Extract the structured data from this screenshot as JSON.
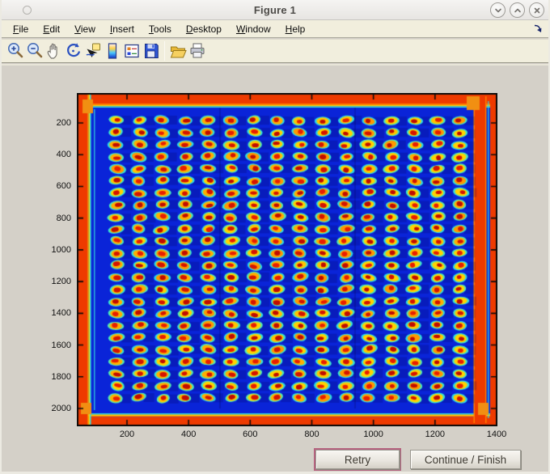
{
  "window": {
    "title": "Figure 1"
  },
  "window_controls": {
    "items": [
      "minimize",
      "maximize",
      "close"
    ]
  },
  "menu": {
    "items": [
      {
        "label": "File"
      },
      {
        "label": "Edit"
      },
      {
        "label": "View"
      },
      {
        "label": "Insert"
      },
      {
        "label": "Tools"
      },
      {
        "label": "Desktop"
      },
      {
        "label": "Window"
      },
      {
        "label": "Help"
      }
    ],
    "dock_icon": "curved-arrow-down-right"
  },
  "toolbar": {
    "buttons": [
      "zoom-in",
      "zoom-out",
      "pan",
      "rotate-3d",
      "data-cursor",
      "insert-colorbar",
      "insert-legend",
      "save-figure",
      "open-file",
      "print-figure"
    ],
    "separator_after": "save-figure"
  },
  "plot": {
    "x_tick_labels": [
      200,
      400,
      600,
      800,
      1000,
      1200,
      1400
    ],
    "y_tick_labels": [
      200,
      400,
      600,
      800,
      1000,
      1200,
      1400,
      1600,
      1800,
      2000
    ],
    "image": {
      "type": "heatmap-image",
      "description": "Jet-colormap scan of a microarray plate: deep blue field with a 16x24 grid of spots (red cores, yellow-orange rings, cyan halos), red-hot plate edges, an inner red vertical band near the right edge and orange corner blobs",
      "grid": {
        "cols": 16,
        "rows": 24
      },
      "colors": {
        "field": "#0a24d8",
        "halos": [
          "#35e3d6",
          "#45e8c0",
          "#2ad8e8",
          "#52eab4"
        ],
        "rings": [
          "#ffc400",
          "#ffae00",
          "#ff9800",
          "#ffd200"
        ],
        "cores": [
          "#e81e00",
          "#d41400",
          "#c00c00"
        ],
        "edge": "#ee3a00",
        "edge_dark": "#7c1300",
        "orange_line": "#ff7e00",
        "yellow_line": "#ffd400",
        "cyan_line": "#35e0e0",
        "corner": "#f18f12"
      }
    }
  },
  "actions": {
    "retry_label": "Retry",
    "continue_label": "Continue / Finish"
  }
}
